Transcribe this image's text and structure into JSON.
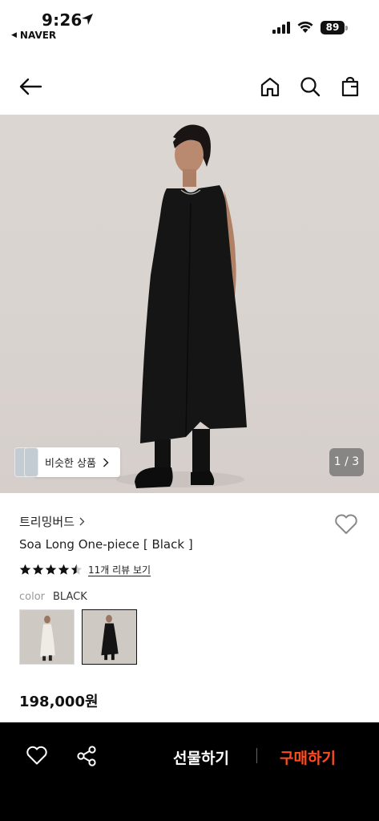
{
  "status_bar": {
    "time": "9:26",
    "back_app": "NAVER",
    "battery": "89"
  },
  "nav": {
    "back_icon": "arrow-left-icon",
    "home_icon": "home-icon",
    "search_icon": "search-icon",
    "bag_icon": "shopping-bag-icon"
  },
  "gallery": {
    "similar_label": "비슷한 상품",
    "pager": "1 / 3"
  },
  "product": {
    "brand": "트리밍버드",
    "name": "Soa Long One-piece [ Black ]",
    "rating": 4.5,
    "review_link": "11개 리뷰 보기",
    "color_label": "color",
    "color_value": "BLACK",
    "swatches": [
      {
        "color": "ivory",
        "selected": false
      },
      {
        "color": "black",
        "selected": true
      }
    ],
    "price": "198,000원"
  },
  "bottom_bar": {
    "gift_label": "선물하기",
    "buy_label": "구매하기",
    "buy_color": "#ff4b1f"
  }
}
